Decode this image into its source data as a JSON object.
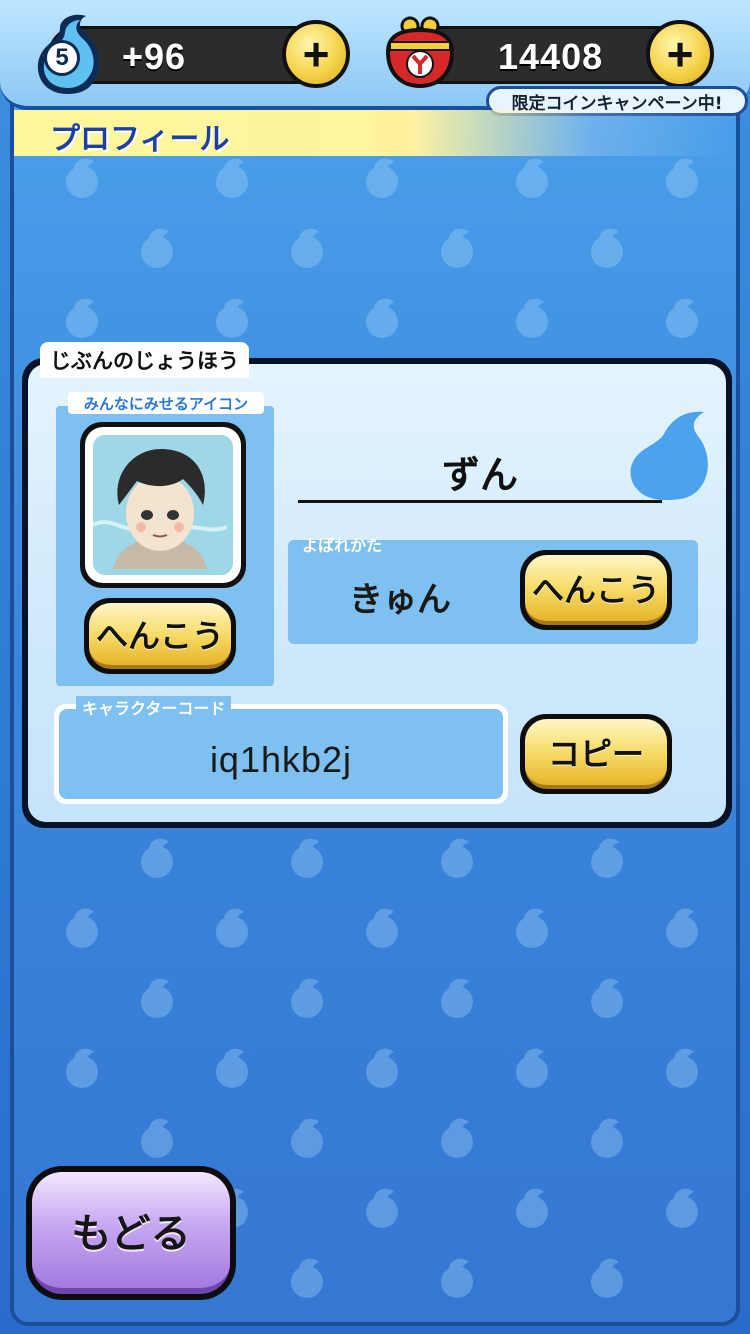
{
  "status_bar": {
    "stamina_level": "5",
    "stamina_bonus": "+96",
    "coins": "14408",
    "campaign_label": "限定コインキャンペーン中!"
  },
  "header": {
    "title": "プロフィール"
  },
  "profile": {
    "section_title": "じぶんのじょうほう",
    "icon_label": "みんなにみせるアイコン",
    "icon_change_label": "へんこう",
    "username": "ずん",
    "call_label": "よばれかた",
    "call_value": "きゅん",
    "call_change_label": "へんこう",
    "code_label": "キャラクターコード",
    "code_value": "iq1hkb2j",
    "copy_label": "コピー"
  },
  "footer": {
    "back_label": "もどる"
  },
  "colors": {
    "accent_gold": "#f7dc69",
    "back_purple": "#c8a8f2",
    "panel_blue": "#7ec0ef",
    "background_blue": "#3a87dc"
  }
}
